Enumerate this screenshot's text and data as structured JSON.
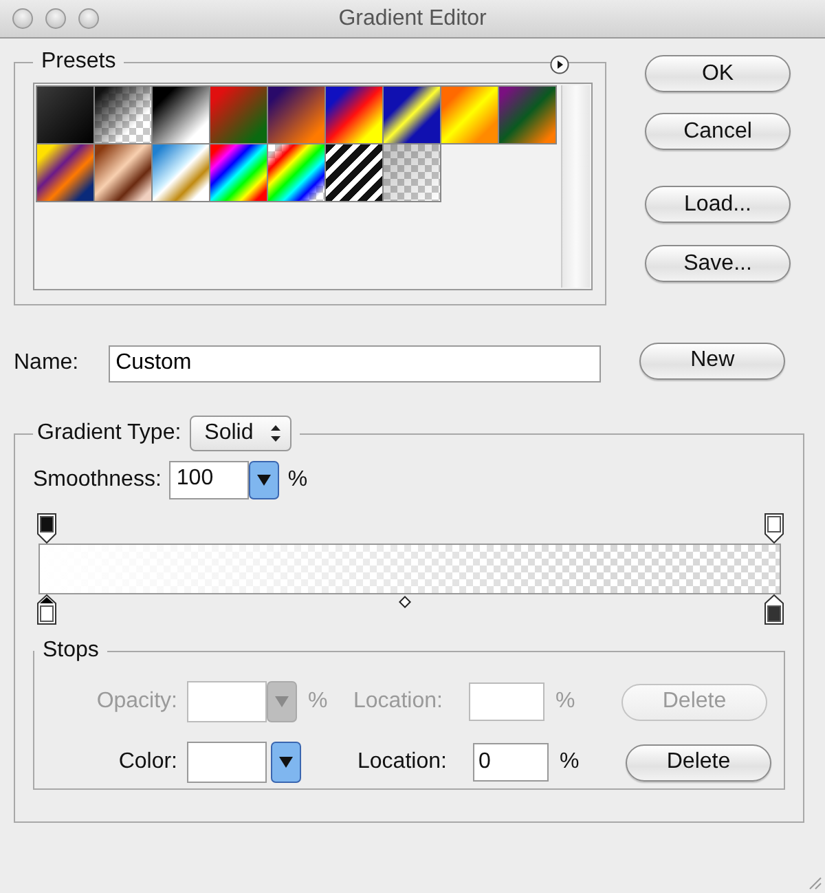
{
  "window": {
    "title": "Gradient Editor"
  },
  "presets": {
    "label": "Presets"
  },
  "buttons": [
    "OK",
    "Cancel",
    "Load...",
    "Save..."
  ],
  "name": {
    "label": "Name:",
    "value": "Custom"
  },
  "new_button": "New",
  "gradient_type": {
    "label": "Gradient Type:",
    "value": "Solid"
  },
  "smoothness": {
    "label": "Smoothness:",
    "value": "100",
    "unit": "%"
  },
  "opacity_stops": [
    {
      "selected": false,
      "level": 1
    },
    {
      "selected": false,
      "level": 0
    }
  ],
  "color_stops": [
    {
      "selected": true,
      "color": "#ffffff"
    },
    {
      "selected": false,
      "color": "#333333"
    }
  ],
  "stops": {
    "label": "Stops",
    "rows": [
      {
        "kind": "opacity",
        "label": "Opacity:",
        "unit": "%",
        "location_label": "Location:",
        "location_unit": "%",
        "button": "Delete",
        "disabled": true
      },
      {
        "kind": "color",
        "label": "Color:",
        "location_label": "Location:",
        "location": "0",
        "location_unit": "%",
        "button": "Delete",
        "disabled": false
      }
    ]
  }
}
